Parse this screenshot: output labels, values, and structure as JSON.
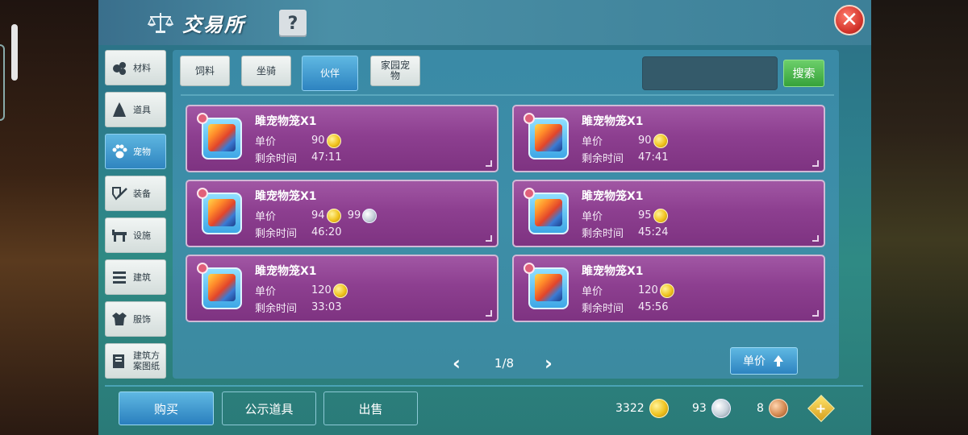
{
  "window": {
    "title": "交易所",
    "help_label": "?",
    "close_label": "✕"
  },
  "categories": [
    {
      "label": "材料",
      "icon": "materials-icon"
    },
    {
      "label": "道具",
      "icon": "item-icon"
    },
    {
      "label": "宠物",
      "icon": "paw-icon",
      "active": true
    },
    {
      "label": "装备",
      "icon": "equipment-icon"
    },
    {
      "label": "设施",
      "icon": "facility-icon"
    },
    {
      "label": "建筑",
      "icon": "building-icon"
    },
    {
      "label": "服饰",
      "icon": "clothing-icon"
    },
    {
      "label": "建筑方案图纸",
      "icon": "blueprint-icon"
    }
  ],
  "tabs": [
    {
      "label": "饲料"
    },
    {
      "label": "坐骑"
    },
    {
      "label": "伙伴",
      "active": true
    },
    {
      "label": "家园宠物"
    }
  ],
  "search": {
    "value": "",
    "button_label": "搜索"
  },
  "listing_labels": {
    "price": "单价",
    "time": "剩余时间"
  },
  "listings": [
    {
      "name": "雎宠物笼X1",
      "gold": "90",
      "silver": "",
      "time": "47:11"
    },
    {
      "name": "雎宠物笼X1",
      "gold": "90",
      "silver": "",
      "time": "47:41"
    },
    {
      "name": "雎宠物笼X1",
      "gold": "94",
      "silver": "99",
      "time": "46:20"
    },
    {
      "name": "雎宠物笼X1",
      "gold": "95",
      "silver": "",
      "time": "45:24"
    },
    {
      "name": "雎宠物笼X1",
      "gold": "120",
      "silver": "",
      "time": "33:03"
    },
    {
      "name": "雎宠物笼X1",
      "gold": "120",
      "silver": "",
      "time": "45:56"
    }
  ],
  "pagination": {
    "text": "1/8",
    "prev": "‹",
    "next": "›"
  },
  "sort": {
    "label": "单价"
  },
  "actions": {
    "buy": "购买",
    "public": "公示道具",
    "sell": "出售"
  },
  "currency": {
    "gold": "3322",
    "silver": "93",
    "copper": "8",
    "add": "+"
  },
  "colors": {
    "card_purple": "#8d3f90",
    "active_blue": "#2d83c0",
    "search_green": "#36a23a",
    "close_red": "#d2332a",
    "gold": "#f0c31f"
  }
}
